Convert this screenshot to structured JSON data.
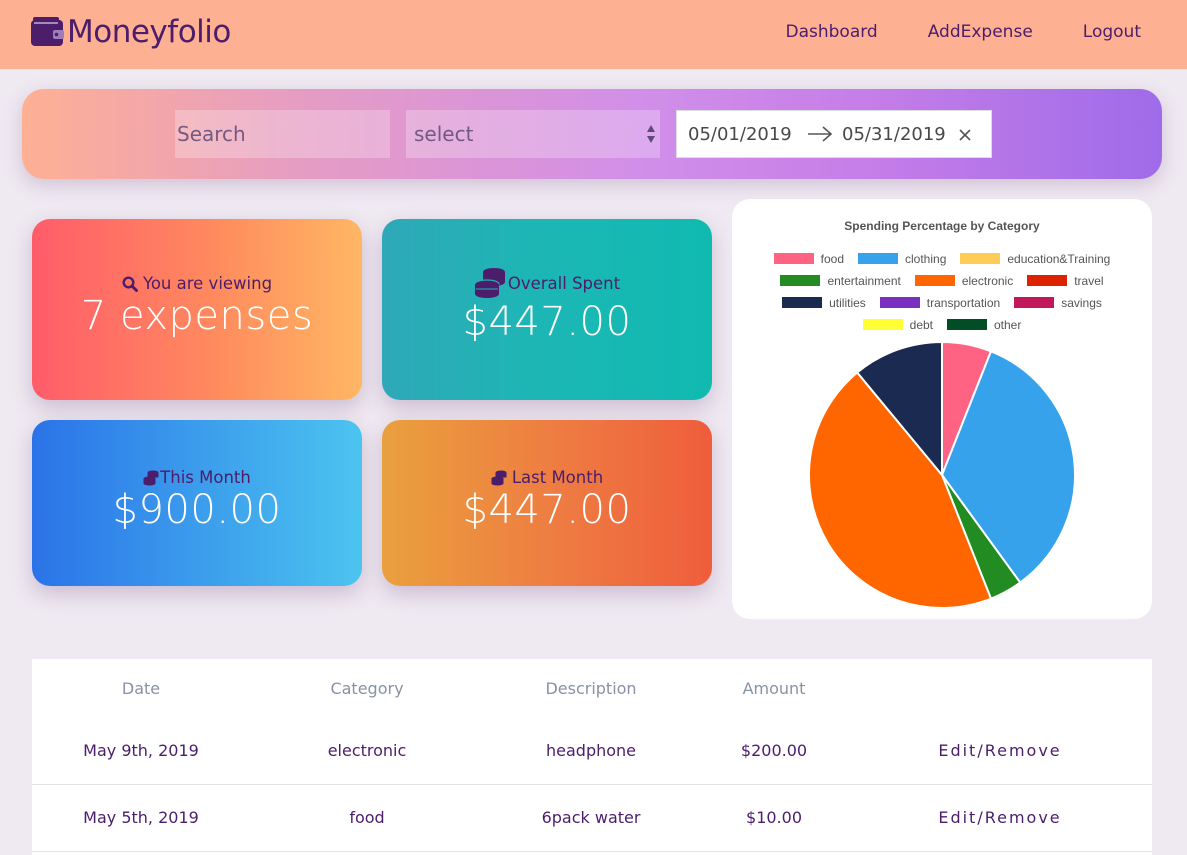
{
  "navbar": {
    "brand": "Moneyfolio",
    "links": [
      "Dashboard",
      "AddExpense",
      "Logout"
    ]
  },
  "filters": {
    "search_placeholder": "Search",
    "select_value": "select",
    "date_start": "05/01/2019",
    "date_end": "05/31/2019"
  },
  "cards": {
    "viewing": {
      "label": "You are viewing",
      "value": "7 expenses",
      "icon": "search-icon"
    },
    "overall": {
      "label": "Overall Spent",
      "value": "$447.00",
      "icon": "coins-icon"
    },
    "this_month": {
      "label": "This Month",
      "value": "$900.00",
      "icon": "coins-icon"
    },
    "last_month": {
      "label": "Last Month",
      "value": "$447.00",
      "icon": "coins-icon"
    }
  },
  "chart_data": {
    "type": "pie",
    "title": "Spending Percentage by Category",
    "legend_position": "top",
    "categories": [
      "food",
      "clothing",
      "education&Training",
      "entertainment",
      "electronic",
      "travel",
      "utilities",
      "transportation",
      "savings",
      "debt",
      "other"
    ],
    "colors": [
      "#ff6384",
      "#36a2eb",
      "#ffcd56",
      "#228b22",
      "#ff6600",
      "#dd2200",
      "#1a2a50",
      "#7b2fbf",
      "#c2185b",
      "#ffff33",
      "#004d26"
    ],
    "values": [
      6,
      34,
      0,
      4,
      45,
      0,
      11,
      0,
      0,
      0,
      0
    ]
  },
  "table": {
    "headers": [
      "Date",
      "Category",
      "Description",
      "Amount"
    ],
    "rows": [
      {
        "date": "May 9th, 2019",
        "category": "electronic",
        "description": "headphone",
        "amount": "$200.00",
        "action": "Edit/Remove"
      },
      {
        "date": "May 5th, 2019",
        "category": "food",
        "description": "6pack water",
        "amount": "$10.00",
        "action": "Edit/Remove"
      }
    ]
  }
}
